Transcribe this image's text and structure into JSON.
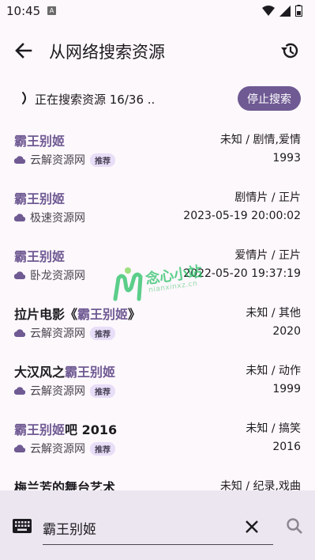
{
  "status_bar": {
    "time": "10:45",
    "indicator": "A"
  },
  "app_bar": {
    "title": "从网络搜索资源"
  },
  "search_status": {
    "progress_text": "正在搜索资源 16/36 ..",
    "stop_label": "停止搜索"
  },
  "results": [
    {
      "title_pre": "",
      "title_hl": "霸王别姬",
      "title_post": "",
      "source": "云解资源网",
      "badge": "推荐",
      "meta": "未知 / 剧情,爱情",
      "date": "1993"
    },
    {
      "title_pre": "",
      "title_hl": "霸王别姬",
      "title_post": "",
      "source": "极速资源网",
      "badge": "",
      "meta": "剧情片 / 正片",
      "date": "2023-05-19 20:00:02"
    },
    {
      "title_pre": "",
      "title_hl": "霸王别姬",
      "title_post": "",
      "source": "卧龙资源网",
      "badge": "",
      "meta": "爱情片 / 正片",
      "date": "2022-05-20 19:37:19"
    },
    {
      "title_pre": "拉片电影《",
      "title_hl": "霸王别姬",
      "title_post": "》",
      "source": "云解资源网",
      "badge": "推荐",
      "meta": "未知 / 其他",
      "date": "2020"
    },
    {
      "title_pre": "大汉风之",
      "title_hl": "霸王别姬",
      "title_post": "",
      "source": "云解资源网",
      "badge": "推荐",
      "meta": "未知 / 动作",
      "date": "1999"
    },
    {
      "title_pre": "",
      "title_hl": "霸王别姬",
      "title_post": "吧 2016",
      "source": "云解资源网",
      "badge": "推荐",
      "meta": "未知 / 搞笑",
      "date": "2016"
    },
    {
      "title_pre": "梅兰芳的舞台艺术",
      "title_hl": "",
      "title_post": "",
      "source": "",
      "badge": "",
      "meta": "未知 / 纪录,戏曲",
      "date": ""
    }
  ],
  "watermark": {
    "text": "念心小站",
    "sub": "nianxinxz.cn"
  },
  "search_bar": {
    "query": "霸王别姬"
  },
  "colors": {
    "accent": "#6f5a93",
    "badge_bg": "#e8def8",
    "bottom_bg": "#ece6f0"
  },
  "icons": [
    "back-arrow-icon",
    "history-icon",
    "cloud-icon",
    "keyboard-icon",
    "close-icon",
    "search-icon",
    "wifi-icon",
    "signal-icon",
    "battery-icon"
  ]
}
